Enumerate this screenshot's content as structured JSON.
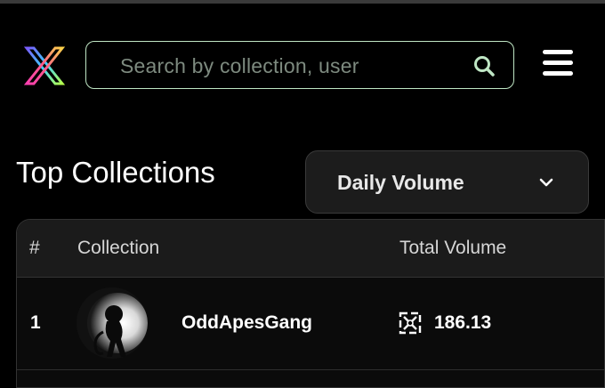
{
  "header": {
    "logo_icon": "x-logo-icon",
    "search": {
      "placeholder": "Search by collection, user",
      "icon": "search-icon",
      "accent": "#bfe6c4"
    },
    "menu_icon": "hamburger-menu-icon"
  },
  "section": {
    "title": "Top Collections",
    "sort_dropdown": {
      "selected": "Daily Volume",
      "icon": "chevron-down-icon"
    }
  },
  "table": {
    "columns": {
      "rank": "#",
      "collection": "Collection",
      "volume": "Total Volume"
    },
    "rows": [
      {
        "rank": "1",
        "name": "OddApesGang",
        "volume": "186.13",
        "volume_icon": "token-icon"
      }
    ]
  }
}
